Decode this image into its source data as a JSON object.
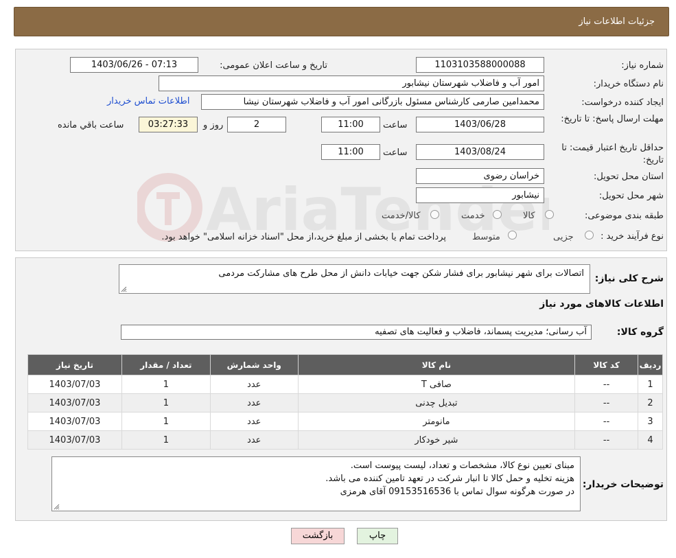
{
  "header": {
    "title": "جزئیات اطلاعات نیاز"
  },
  "fields": {
    "need_number_label": "شماره نیاز:",
    "need_number": "1103103588000088",
    "announce_label": "تاریخ و ساعت اعلان عمومی:",
    "announce_value": "1403/06/26 - 07:13",
    "buyer_label": "نام دستگاه خریدار:",
    "buyer_value": "امور آب و فاضلاب شهرستان نیشابور",
    "creator_label": "ایجاد کننده درخواست:",
    "creator_value": "محمدامین صارمی کارشناس مسئول بازرگانی امور آب و فاضلاب شهرستان نیشا",
    "contact_link": "اطلاعات تماس خریدار",
    "deadline_label": "مهلت ارسال پاسخ: تا تاریخ:",
    "deadline_date": "1403/06/28",
    "time_label": "ساعت",
    "deadline_time": "11:00",
    "days_value": "2",
    "days_label": "روز و",
    "remaining_time": "03:27:33",
    "remaining_label": "ساعت باقي مانده",
    "validity_label": "حداقل تاریخ اعتبار قیمت: تا تاریخ:",
    "validity_date": "1403/08/24",
    "validity_time": "11:00",
    "province_label": "استان محل تحویل:",
    "province_value": "خراسان رضوی",
    "city_label": "شهر محل تحویل:",
    "city_value": "نیشابور",
    "category_label": "طبقه بندی موضوعی:",
    "category_options": [
      "کالا",
      "خدمت",
      "کالا/خدمت"
    ],
    "process_label": "نوع فرآیند خرید :",
    "process_options": [
      "جزیی",
      "متوسط"
    ],
    "process_note": "پرداخت تمام یا بخشی از مبلغ خرید،از محل \"اسناد خزانه اسلامی\" خواهد بود."
  },
  "watermark_text": "AriaTender.neT",
  "general": {
    "desc_label": "شرح کلی نیاز:",
    "desc_value": "اتصالات برای شهر نیشابور برای فشار شکن جهت خیابات دانش از محل طرح های مشارکت مردمی",
    "goods_info_title": "اطلاعات کالاهای مورد نیاز",
    "goods_group_label": "گروه کالا:",
    "goods_group_value": "آب رسانی؛ مدیریت پسماند، فاضلاب و فعالیت های تصفیه"
  },
  "table": {
    "headers": [
      "ردیف",
      "کد کالا",
      "نام کالا",
      "واحد شمارش",
      "تعداد / مقدار",
      "تاریخ نیاز"
    ],
    "rows": [
      [
        "1",
        "--",
        "صافی T",
        "عدد",
        "1",
        "1403/07/03"
      ],
      [
        "2",
        "--",
        "تبدیل چدنی",
        "عدد",
        "1",
        "1403/07/03"
      ],
      [
        "3",
        "--",
        "مانومتر",
        "عدد",
        "1",
        "1403/07/03"
      ],
      [
        "4",
        "--",
        "شیر خودکار",
        "عدد",
        "1",
        "1403/07/03"
      ]
    ]
  },
  "buyer_notes": {
    "label": "توضیحات خریدار:",
    "lines": [
      "مبنای تعیین نوع کالا، مشخصات و تعداد، لیست پیوست است.",
      "هزینه تخلیه و حمل کالا تا انبار شرکت در تعهد تامین کننده می باشد.",
      "در صورت هرگونه سوال تماس با 09153516536 آقای هرمزی"
    ]
  },
  "buttons": {
    "back": "بازگشت",
    "print": "چاپ"
  }
}
